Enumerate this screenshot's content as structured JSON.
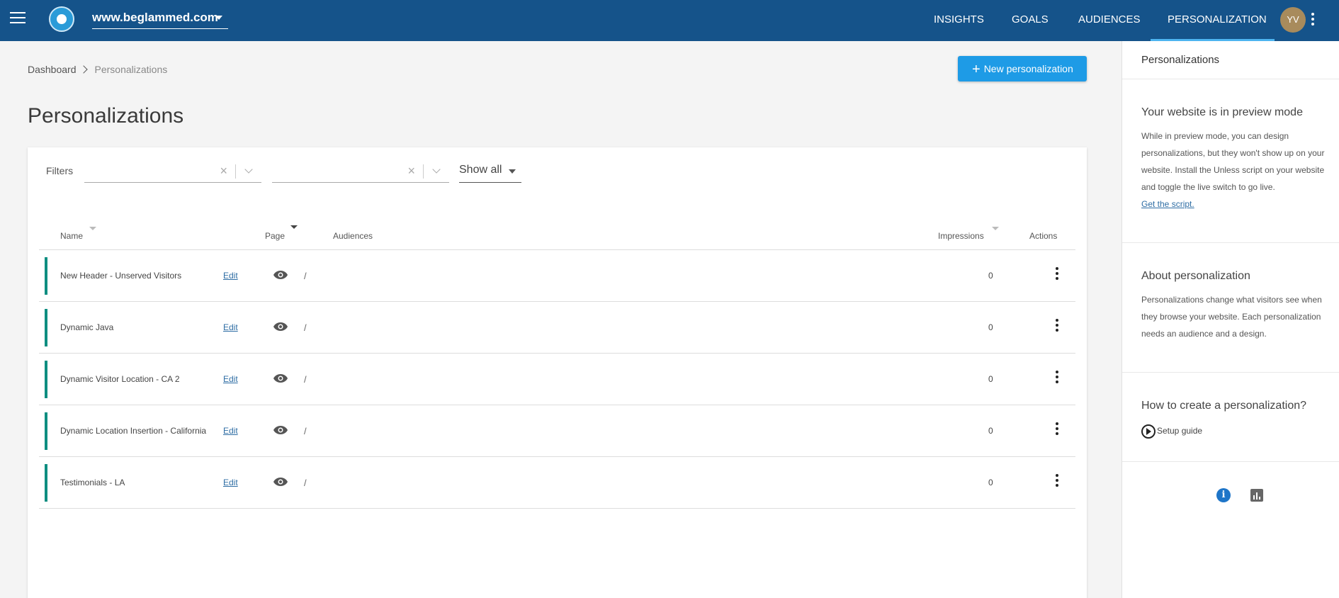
{
  "topbar": {
    "site": "www.beglammed.com",
    "nav": [
      "INSIGHTS",
      "GOALS",
      "AUDIENCES",
      "PERSONALIZATION"
    ],
    "avatar_initials": "YV"
  },
  "breadcrumb": {
    "root": "Dashboard",
    "current": "Personalizations"
  },
  "new_button_label": "New personalization",
  "page_title": "Personalizations",
  "filters": {
    "label": "Filters",
    "show_select_value": "Show all"
  },
  "table": {
    "headers": {
      "name": "Name",
      "page": "Page",
      "audiences": "Audiences",
      "impressions": "Impressions",
      "actions": "Actions"
    },
    "rows": [
      {
        "name": "New Header - Unserved Visitors",
        "edit": "Edit",
        "page": "/",
        "impressions": "0"
      },
      {
        "name": "Dynamic Java",
        "edit": "Edit",
        "page": "/",
        "impressions": "0"
      },
      {
        "name": "Dynamic Visitor Location - CA 2",
        "edit": "Edit",
        "page": "/",
        "impressions": "0"
      },
      {
        "name": "Dynamic Location Insertion - California",
        "edit": "Edit",
        "page": "/",
        "impressions": "0"
      },
      {
        "name": "Testimonials - LA",
        "edit": "Edit",
        "page": "/",
        "impressions": "0"
      }
    ],
    "status_color": "#0e8e81"
  },
  "panel": {
    "title": "Personalizations",
    "preview": {
      "title": "Your website is in preview mode",
      "text": "While in preview mode, you can design personalizations, but they won't show up on your website. Install the Unless script on your website and toggle the live switch to go live.",
      "link": "Get the script."
    },
    "about": {
      "title": "About personalization",
      "text": "Personalizations change what visitors see when they browse your website. Each personalization needs an audience and a design."
    },
    "howto": {
      "title": "How to create a personalization?",
      "guide": "Setup guide"
    },
    "icon_info": "i"
  },
  "colors": {
    "topbar": "#15538a",
    "primary_button": "#1e9be6",
    "active_tab_underline": "#4db4f0"
  }
}
